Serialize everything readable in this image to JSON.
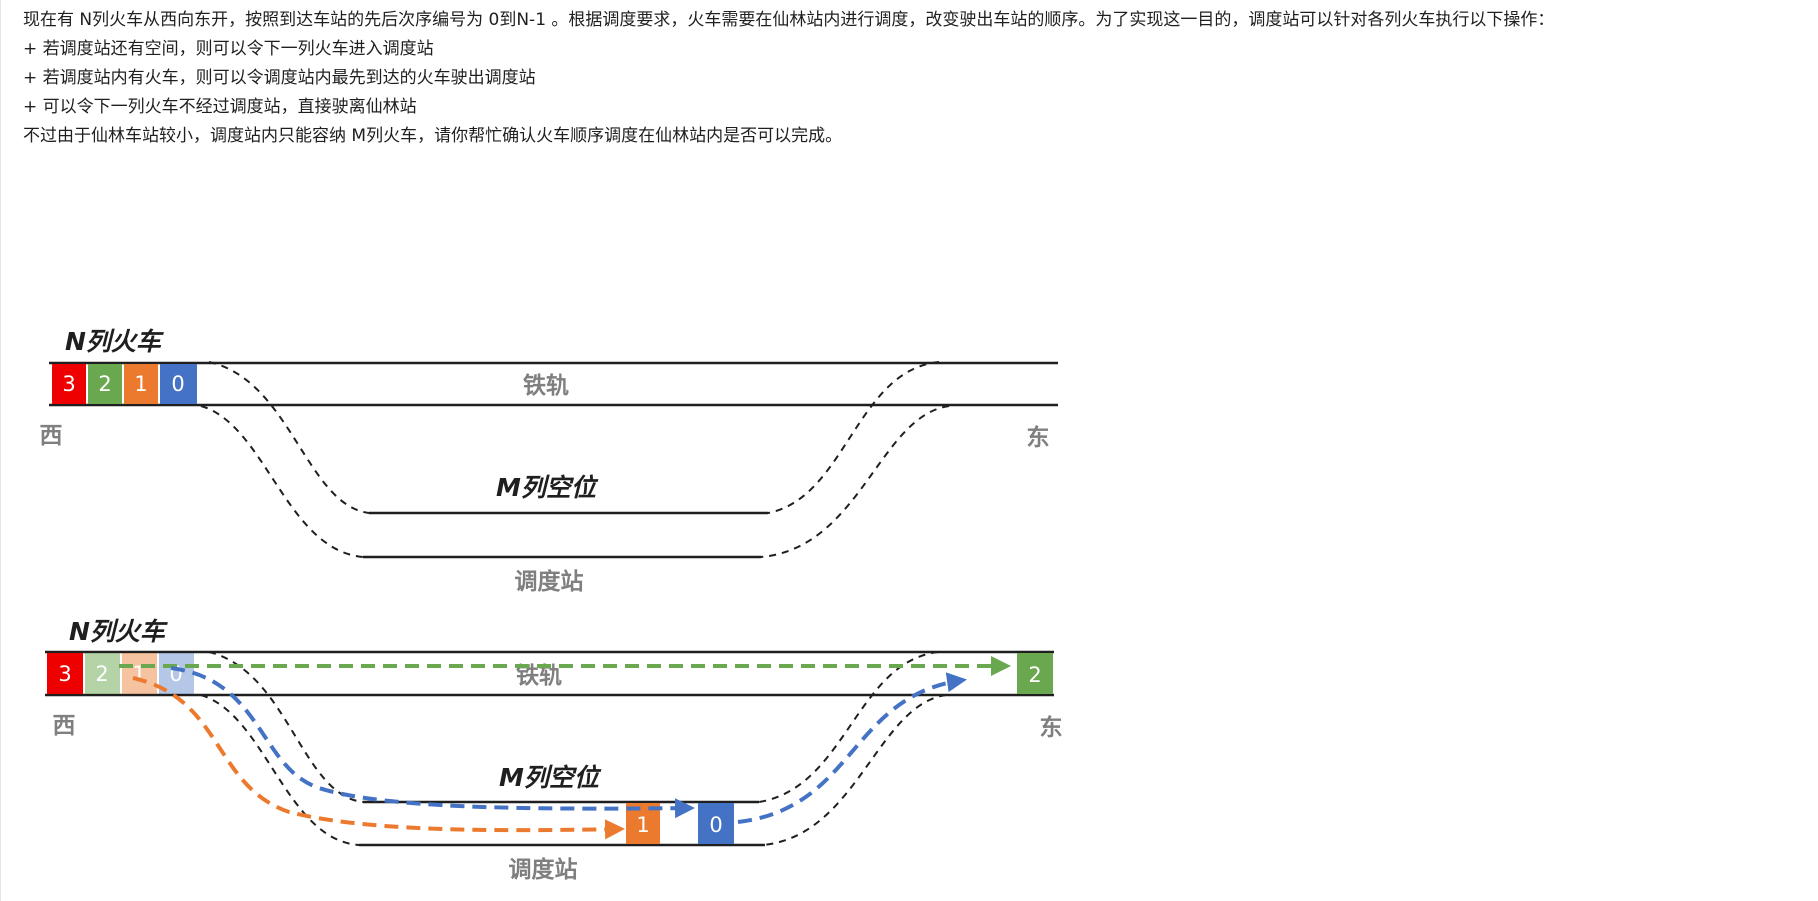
{
  "problem": {
    "intro": "现在有 N列火车从西向东开，按照到达车站的先后次序编号为 0到N-1 。根据调度要求，火车需要在仙林站内进行调度，改变驶出车站的顺序。为了实现这一目的，调度站可以针对各列火车执行以下操作：",
    "rules": [
      "+ 若调度站还有空间，则可以令下一列火车进入调度站",
      "+ 若调度站内有火车，则可以令调度站内最先到达的火车驶出调度站",
      "+ 可以令下一列火车不经过调度站，直接驶离仙林站"
    ],
    "conclusion": "不过由于仙林车站较小，调度站内只能容纳 M列火车，请你帮忙确认火车顺序调度在仙林站内是否可以完成。"
  },
  "diagram_top": {
    "trains_label": "N列火车",
    "track_label": "铁轨",
    "west_label": "西",
    "east_label": "东",
    "slots_label": "M列空位",
    "station_label": "调度站",
    "cars": [
      "3",
      "2",
      "1",
      "0"
    ]
  },
  "diagram_bottom": {
    "trains_label": "N列火车",
    "track_label": "铁轨",
    "west_label": "西",
    "east_label": "东",
    "slots_label": "M列空位",
    "station_label": "调度站",
    "cars": [
      "3",
      "2",
      "1",
      "0"
    ],
    "exit_car": "2",
    "station_cars": [
      "1",
      "0"
    ]
  },
  "colors": {
    "red": "#ee0000",
    "green": "#6aa84f",
    "orange": "#ec7a2e",
    "blue": "#4472c4",
    "label_gray": "#7f7f7f"
  }
}
